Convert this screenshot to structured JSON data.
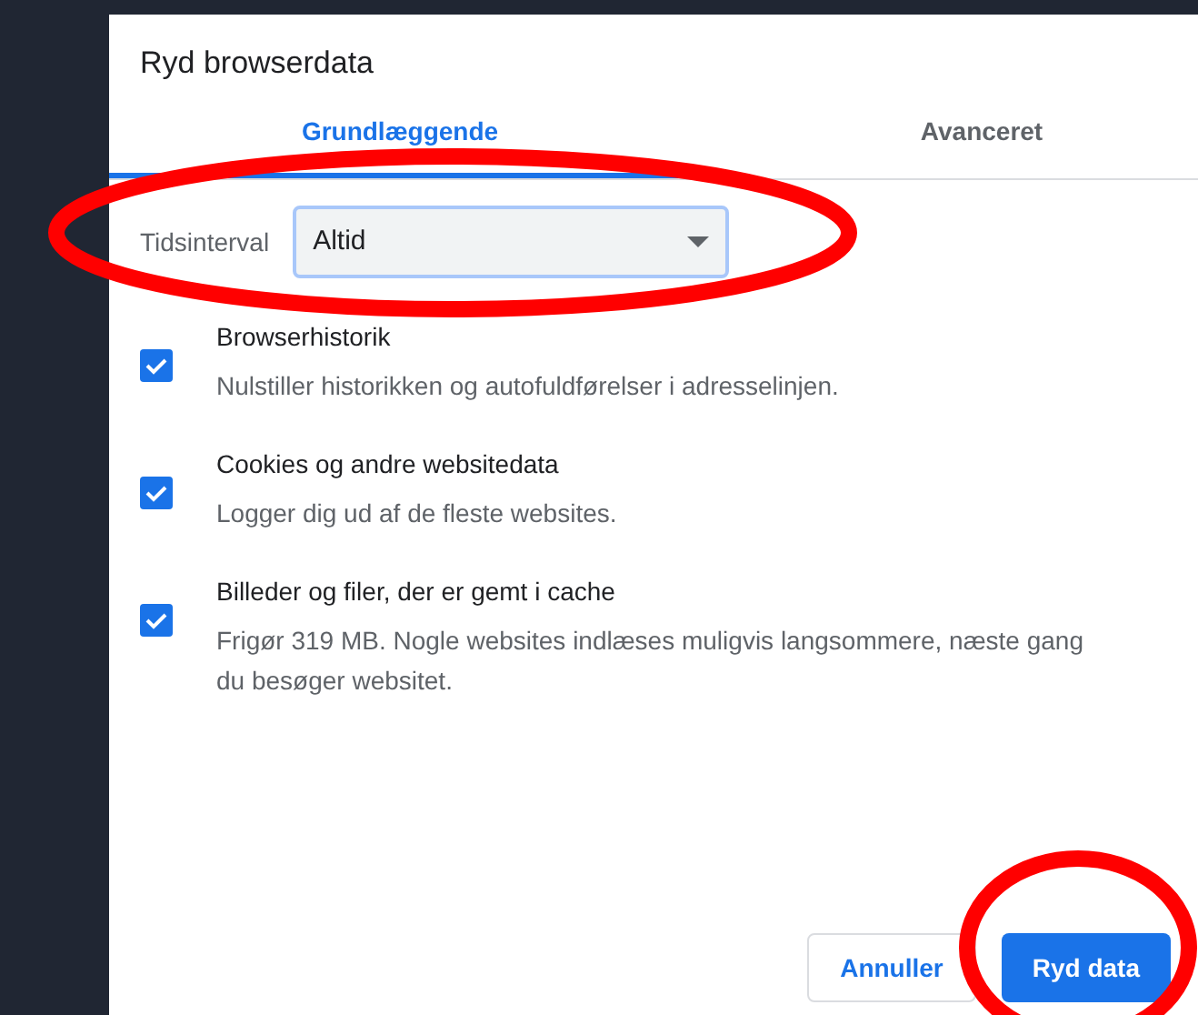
{
  "dialog": {
    "title": "Ryd browserdata"
  },
  "tabs": [
    {
      "label": "Grundlæggende",
      "selected": true
    },
    {
      "label": "Avanceret",
      "selected": false
    }
  ],
  "time_range": {
    "label": "Tidsinterval",
    "value": "Altid"
  },
  "options": [
    {
      "title": "Browserhistorik",
      "description": "Nulstiller historikken og autofuldførelser i adresselinjen.",
      "checked": true
    },
    {
      "title": "Cookies og andre websitedata",
      "description": "Logger dig ud af de fleste websites.",
      "checked": true
    },
    {
      "title": "Billeder og filer, der er gemt i cache",
      "description": "Frigør 319 MB. Nogle websites indlæses muligvis langsommere, næste gang du besøger websitet.",
      "checked": true
    }
  ],
  "buttons": [
    {
      "label": "Annuller",
      "kind": "secondary"
    },
    {
      "label": "Ryd data",
      "kind": "primary"
    }
  ]
}
